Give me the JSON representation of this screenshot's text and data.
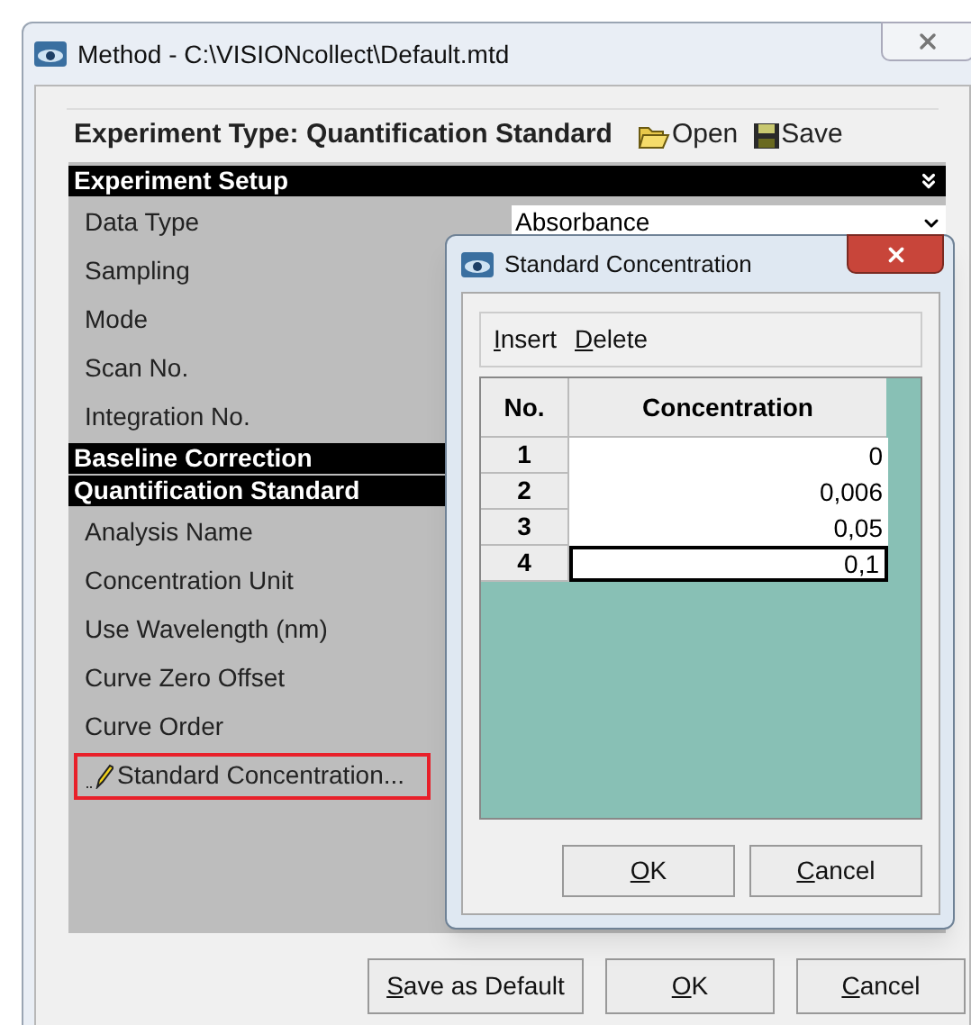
{
  "window": {
    "title": "Method - C:\\VISIONcollect\\Default.mtd"
  },
  "header": {
    "label": "Experiment Type:",
    "value": "Quantification Standard",
    "actions": [
      {
        "label": "Open",
        "kind": "open"
      },
      {
        "label": "Save",
        "kind": "save"
      }
    ]
  },
  "items": [
    {
      "kind": "section",
      "label": "Experiment Setup",
      "toggle": true
    },
    {
      "kind": "property",
      "label": "Data Type",
      "value": "Absorbance",
      "dropdown": true
    },
    {
      "kind": "property",
      "label": "Sampling"
    },
    {
      "kind": "property",
      "label": "Mode"
    },
    {
      "kind": "property",
      "label": "Scan No."
    },
    {
      "kind": "property",
      "label": "Integration No."
    },
    {
      "kind": "section",
      "label": "Baseline Correction"
    },
    {
      "kind": "section",
      "label": "Quantification Standard"
    },
    {
      "kind": "property",
      "label": "Analysis Name"
    },
    {
      "kind": "property",
      "label": "Concentration Unit"
    },
    {
      "kind": "property",
      "label": "Use Wavelength (nm)"
    },
    {
      "kind": "property",
      "label": "Curve Zero Offset"
    },
    {
      "kind": "property",
      "label": "Curve Order"
    },
    {
      "kind": "action",
      "label": "Standard Concentration...",
      "highlighted": true
    }
  ],
  "buttons": [
    "Save as Default",
    "OK",
    "Cancel"
  ],
  "dialog": {
    "title": "Standard Concentration",
    "toolbar": [
      "Insert",
      "Delete"
    ],
    "columns": [
      "No.",
      "Concentration"
    ],
    "rows": [
      {
        "no": "1",
        "concentration": "0",
        "selected": false
      },
      {
        "no": "2",
        "concentration": "0,006",
        "selected": false
      },
      {
        "no": "3",
        "concentration": "0,05",
        "selected": false
      },
      {
        "no": "4",
        "concentration": "0,1",
        "selected": true
      }
    ],
    "buttons": [
      "OK",
      "Cancel"
    ]
  }
}
